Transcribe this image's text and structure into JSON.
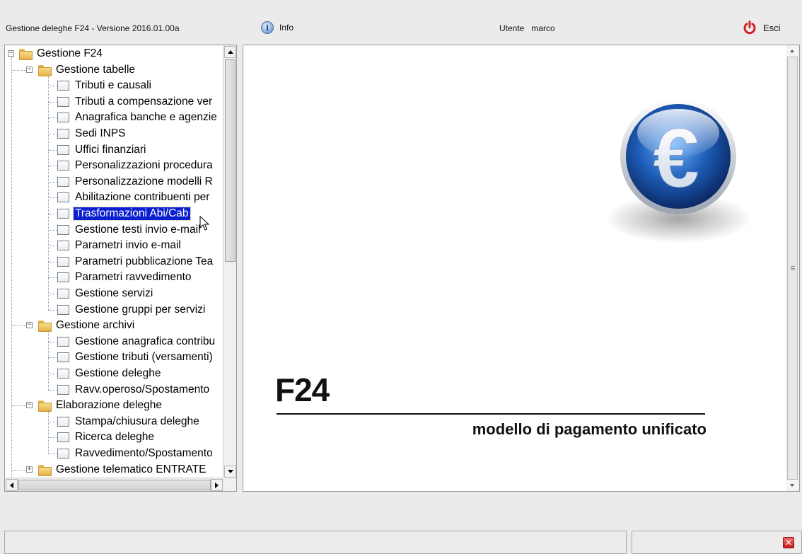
{
  "app": {
    "title": "Gestione deleghe F24 - Versione 2016.01.00a",
    "info_label": "Info",
    "user_label": "Utente",
    "user_name": "marco",
    "exit_label": "Esci"
  },
  "tree": {
    "root": "Gestione F24",
    "groups": [
      {
        "label": "Gestione tabelle",
        "items": [
          "Tributi e causali",
          "Tributi a compensazione ver",
          "Anagrafica banche e agenzie",
          "Sedi INPS",
          "Uffici finanziari",
          "Personalizzazioni procedura",
          "Personalizzazione modelli R",
          "Abilitazione contribuenti per",
          "Trasformazioni Abi/Cab",
          "Gestione testi invio e-mail",
          "Parametri invio e-mail",
          "Parametri pubblicazione Tea",
          "Parametri ravvedimento",
          "Gestione servizi",
          "Gestione gruppi per servizi"
        ]
      },
      {
        "label": "Gestione archivi",
        "items": [
          "Gestione anagrafica contribu",
          "Gestione tributi (versamenti)",
          "Gestione deleghe",
          "Ravv.operoso/Spostamento"
        ]
      },
      {
        "label": "Elaborazione deleghe",
        "items": [
          "Stampa/chiusura deleghe",
          "Ricerca deleghe",
          "Ravvedimento/Spostamento"
        ]
      },
      {
        "label": "Gestione telematico ENTRATE",
        "items": []
      }
    ],
    "selected": "Trasformazioni Abi/Cab"
  },
  "banner": {
    "title": "F24",
    "subtitle": "modello di pagamento unificato",
    "logo_symbol": "€"
  },
  "colors": {
    "selection": "#0a20d0",
    "logo_blue": "#1e5db8"
  }
}
